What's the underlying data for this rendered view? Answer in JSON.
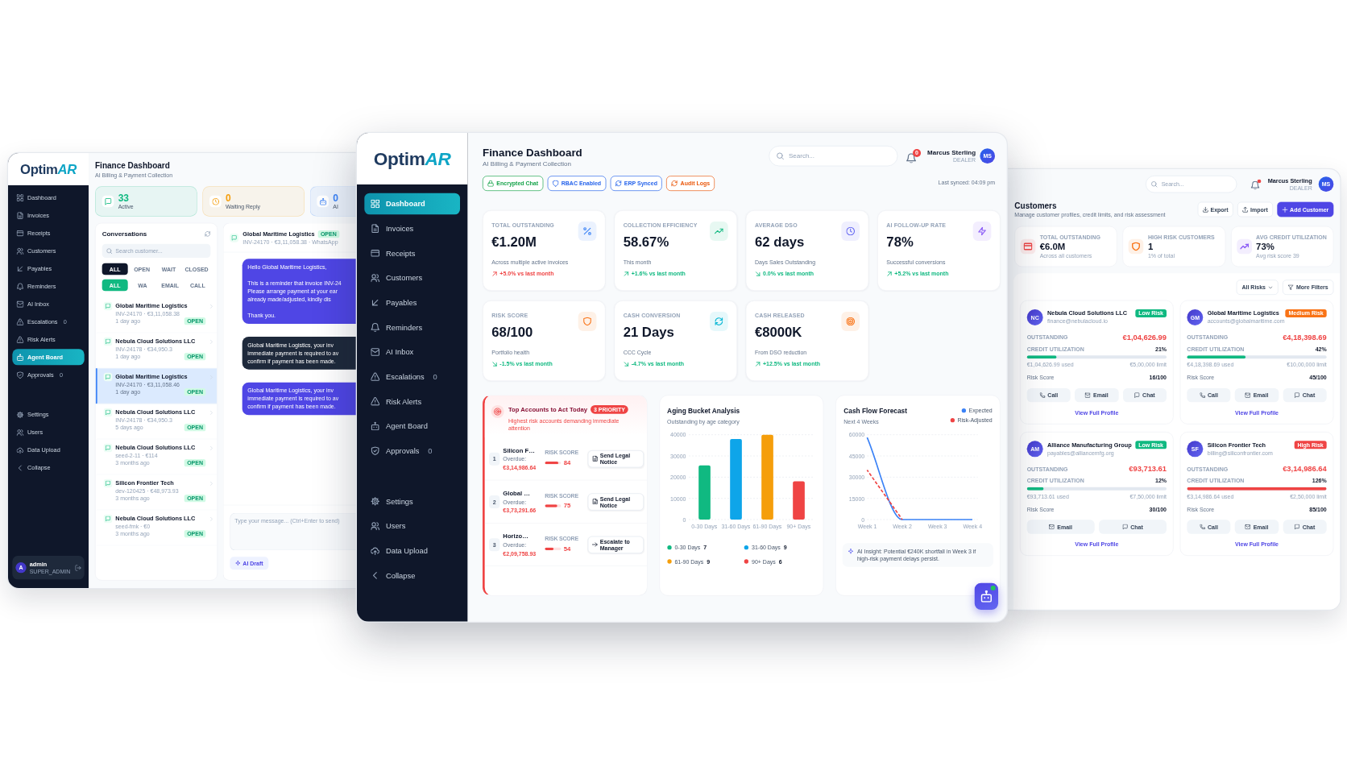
{
  "left_screen": {
    "logo": {
      "text": "Optim",
      "accent": "AR"
    },
    "sidebar": {
      "items": [
        {
          "label": "Dashboard",
          "selected": false
        },
        {
          "label": "Invoices",
          "selected": false
        },
        {
          "label": "Receipts",
          "selected": false
        },
        {
          "label": "Customers",
          "selected": false
        },
        {
          "label": "Payables",
          "selected": false
        },
        {
          "label": "Reminders",
          "selected": false
        },
        {
          "label": "AI Inbox",
          "selected": false
        },
        {
          "label": "Escalations",
          "count": "0",
          "selected": false
        },
        {
          "label": "Risk Alerts",
          "selected": false
        },
        {
          "label": "Agent Board",
          "selected": true
        },
        {
          "label": "Approvals",
          "count": "0",
          "selected": false
        }
      ],
      "footer_items": [
        {
          "label": "Settings",
          "selected": false
        },
        {
          "label": "Users",
          "selected": false
        },
        {
          "label": "Data Upload",
          "selected": false
        },
        {
          "label": "Collapse",
          "selected": false
        }
      ]
    },
    "account": {
      "initial": "A",
      "name": "admin",
      "role": "SUPER_ADMIN"
    },
    "header": {
      "title": "Finance Dashboard",
      "subtitle": "AI Billing & Payment Collection"
    },
    "stats": [
      {
        "value": "33",
        "label": "Active",
        "color": "#10b981"
      },
      {
        "value": "0",
        "label": "Waiting Reply",
        "color": "#f59e0b"
      },
      {
        "value": "0",
        "label": "AI",
        "color": "#3b82f6"
      }
    ],
    "conversations": {
      "title": "Conversations",
      "search": {
        "placeholder": "Search customer..."
      },
      "status_filters": [
        {
          "label": "ALL",
          "selected": true
        },
        {
          "label": "OPEN",
          "selected": false
        },
        {
          "label": "WAIT",
          "selected": false
        },
        {
          "label": "CLOSED",
          "selected": false
        }
      ],
      "channel_filters": [
        {
          "label": "ALL",
          "selected": true
        },
        {
          "label": "WA",
          "selected": false
        },
        {
          "label": "EMAIL",
          "selected": false
        },
        {
          "label": "CALL",
          "selected": false
        }
      ],
      "items": [
        {
          "name": "Global Maritime Logistics",
          "status": "OPEN",
          "detail": "INV-24170 · €3,11,058.38",
          "time": "1 day ago",
          "selected": false
        },
        {
          "name": "Nebula Cloud Solutions LLC",
          "status": "OPEN",
          "detail": "INV-24178 · €34,950.3",
          "time": "1 day ago",
          "selected": false
        },
        {
          "name": "Global Maritime Logistics",
          "status": "OPEN",
          "detail": "INV-24170 · €3,11,058.46",
          "time": "1 day ago",
          "selected": true
        },
        {
          "name": "Nebula Cloud Solutions LLC",
          "status": "OPEN",
          "detail": "INV-24178 · €34,950.3",
          "time": "5 days ago",
          "selected": false
        },
        {
          "name": "Nebula Cloud Solutions LLC",
          "status": "OPEN",
          "detail": "seed-2-11 · €114",
          "time": "3 months ago",
          "selected": false
        },
        {
          "name": "Silicon Frontier Tech",
          "status": "OPEN",
          "detail": "dev-120425 · €48,973.93",
          "time": "3 months ago",
          "selected": false
        },
        {
          "name": "Nebula Cloud Solutions LLC",
          "status": "OPEN",
          "detail": "seed-fmk · €0",
          "time": "3 months ago",
          "selected": false
        }
      ]
    },
    "chat": {
      "name": "Global Maritime Logistics",
      "status": "OPEN",
      "detail": "INV-24170 · €3,11,058.38 · WhatsApp",
      "messages": [
        {
          "kind": "auto",
          "paragraphs": [
            [
              "Hello Global Maritime Logistics,"
            ],
            [
              "This is a reminder that invoice INV-24",
              "Please arrange payment at your ear",
              "already made/adjusted, kindly dis"
            ],
            [
              "Thank you."
            ]
          ]
        },
        {
          "kind": "manual",
          "paragraphs": [
            [
              "Global Maritime Logistics, your inv",
              "immediate payment is required to av",
              "confirm if payment has been made."
            ]
          ]
        },
        {
          "kind": "auto",
          "paragraphs": [
            [
              "Global Maritime Logistics, your inv",
              "immediate payment is required to av",
              "confirm if payment has been made."
            ]
          ]
        }
      ],
      "composer": {
        "placeholder": "Type your message... (Ctrl+Enter to send)"
      },
      "draft_button": "AI Draft"
    }
  },
  "center_screen": {
    "logo": {
      "text": "Optim",
      "accent": "AR"
    },
    "sidebar": {
      "items": [
        {
          "label": "Dashboard",
          "selected": true
        },
        {
          "label": "Invoices",
          "selected": false
        },
        {
          "label": "Receipts",
          "selected": false
        },
        {
          "label": "Customers",
          "selected": false
        },
        {
          "label": "Payables",
          "selected": false
        },
        {
          "label": "Reminders",
          "selected": false
        },
        {
          "label": "AI Inbox",
          "selected": false
        },
        {
          "label": "Escalations",
          "count": "0",
          "selected": false
        },
        {
          "label": "Risk Alerts",
          "selected": false
        },
        {
          "label": "Agent Board",
          "selected": false
        },
        {
          "label": "Approvals",
          "count": "0",
          "selected": false
        }
      ],
      "footer_items": [
        {
          "label": "Settings",
          "selected": false
        },
        {
          "label": "Users",
          "selected": false
        },
        {
          "label": "Data Upload",
          "selected": false
        },
        {
          "label": "Collapse",
          "selected": false
        }
      ]
    },
    "header": {
      "title": "Finance Dashboard",
      "subtitle": "AI Billing & Payment Collection",
      "chips": [
        {
          "label": "Encrypted Chat",
          "color": "#16a34a"
        },
        {
          "label": "RBAC Enabled",
          "color": "#2563eb"
        },
        {
          "label": "ERP Synced",
          "color": "#2563eb"
        },
        {
          "label": "Audit Logs",
          "color": "#ea580c"
        }
      ],
      "search": {
        "placeholder": "Search..."
      },
      "notifications": "0",
      "user": {
        "name": "Marcus Sterling",
        "role": "DEALER",
        "initials": "MS"
      },
      "last_synced": "Last synced: 04:09 pm"
    },
    "kpis": [
      {
        "label": "TOTAL OUTSTANDING",
        "value": "€1.20M",
        "caption": "Across multiple active invoices",
        "trend": {
          "text": "+5.0% vs last month",
          "up": true,
          "alert": true
        }
      },
      {
        "label": "COLLECTION EFFICIENCY",
        "value": "58.67%",
        "caption": "This month",
        "trend": {
          "text": "+1.6% vs last month",
          "up": true,
          "alert": false
        }
      },
      {
        "label": "AVERAGE DSO",
        "value": "62 days",
        "caption": "Days Sales Outstanding",
        "trend": {
          "text": "0.0% vs last month",
          "up": false,
          "alert": false
        }
      },
      {
        "label": "AI FOLLOW-UP RATE",
        "value": "78%",
        "caption": "Successful conversions",
        "trend": {
          "text": "+5.2% vs last month",
          "up": true,
          "alert": false
        }
      },
      {
        "label": "RISK SCORE",
        "value": "68/100",
        "caption": "Portfolio health",
        "trend": {
          "text": "-1.5% vs last month",
          "up": false,
          "alert": false
        }
      },
      {
        "label": "CASH CONVERSION",
        "value": "21 Days",
        "caption": "CCC Cycle",
        "trend": {
          "text": "-4.7% vs last month",
          "up": false,
          "alert": false
        }
      },
      {
        "label": "CASH RELEASED",
        "value": "€8000K",
        "caption": "From DSO reduction",
        "trend": {
          "text": "+12.5% vs last month",
          "up": true,
          "alert": false
        }
      }
    ],
    "top_accounts": {
      "title": "Top Accounts to Act Today",
      "badge": "3 PRIORITY",
      "subtitle": "Highest risk accounts demanding immediate attention",
      "rows": [
        {
          "rank": "1",
          "name": "Silicon F…",
          "overdue_label": "Overdue:",
          "amount": "€3,14,986.64",
          "score_label": "RISK SCORE",
          "level": 0.84,
          "score": "84",
          "action": {
            "label": "Send Legal Notice",
            "kind": "legal"
          }
        },
        {
          "rank": "2",
          "name": "Global …",
          "overdue_label": "Overdue:",
          "amount": "€3,73,291.66",
          "score_label": "RISK SCORE",
          "level": 0.75,
          "score": "75",
          "action": {
            "label": "Send Legal Notice",
            "kind": "legal"
          }
        },
        {
          "rank": "3",
          "name": "Horizo…",
          "overdue_label": "Overdue:",
          "amount": "€2,09,758.93",
          "score_label": "RISK SCORE",
          "level": 0.54,
          "score": "54",
          "action": {
            "label": "Escalate to Manager",
            "kind": "escalate"
          }
        }
      ]
    },
    "aging": {
      "title": "Aging Bucket Analysis",
      "subtitle": "Outstanding by age category",
      "chart_data": {
        "type": "bar",
        "categories": [
          "0-30 Days",
          "31-60 Days",
          "61-90 Days",
          "90+ Days"
        ],
        "values": [
          25500,
          38000,
          40000,
          18000
        ],
        "ylim": [
          0,
          40000
        ],
        "yticks": [
          0,
          10000,
          20000,
          30000,
          40000
        ],
        "grid": true
      },
      "legend": [
        {
          "label": "0-30 Days",
          "count": "7",
          "color": "#10b981"
        },
        {
          "label": "31-60 Days",
          "count": "9",
          "color": "#0ea5e9"
        },
        {
          "label": "61-90 Days",
          "count": "9",
          "color": "#f59e0b"
        },
        {
          "label": "90+ Days",
          "count": "6",
          "color": "#ef4444"
        }
      ]
    },
    "cash_flow": {
      "title": "Cash Flow Forecast",
      "subtitle": "Next 4 Weeks",
      "chart_data": {
        "type": "line",
        "categories": [
          "Week 1",
          "Week 2",
          "Week 3",
          "Week 4"
        ],
        "series": [
          {
            "name": "Expected",
            "color": "#3b82f6",
            "values": [
              58000,
              0,
              0,
              0
            ],
            "line_style": "solid"
          },
          {
            "name": "Risk-Adjusted",
            "color": "#ef4444",
            "values": [
              35000,
              0,
              null,
              null
            ],
            "line_style": "dashed"
          }
        ],
        "ylim": [
          0,
          60000
        ],
        "yticks": [
          0,
          15000,
          30000,
          45000,
          60000
        ],
        "grid": true
      },
      "insight": "AI Insight: Potential €240K shortfall in Week 3 if high-risk payment delays persist."
    },
    "assistant": {
      "online": true
    }
  },
  "right_screen": {
    "search": {
      "placeholder": "Search..."
    },
    "notifications_unread": true,
    "user": {
      "name": "Marcus Sterling",
      "role": "DEALER",
      "initials": "MS"
    },
    "title": "Customers",
    "subtitle": "Manage customer profiles, credit limits, and risk assessment",
    "actions": [
      {
        "label": "Export",
        "kind": "export"
      },
      {
        "label": "Import",
        "kind": "import"
      },
      {
        "label": "Add Customer",
        "kind": "add"
      }
    ],
    "stats": [
      {
        "label": "TOTAL OUTSTANDING",
        "value": "€6.0M",
        "caption": "Across all customers",
        "color": "#ef4444"
      },
      {
        "label": "HIGH RISK CUSTOMERS",
        "value": "1",
        "caption": "1% of total",
        "color": "#f97316"
      },
      {
        "label": "AVG CREDIT UTILIZATION",
        "value": "73%",
        "caption": "Avg risk score 39",
        "color": "#8b5cf6"
      }
    ],
    "filters": {
      "risk": "All Risks",
      "more": "More Filters"
    },
    "customers": [
      {
        "initials": "NC",
        "name": "Nebula Cloud Solutions LLC",
        "email": "finance@nebulacloud.io",
        "risk": {
          "label": "Low Risk",
          "color": "#10b981"
        },
        "outstanding_label": "OUTSTANDING",
        "outstanding": "€1,04,626.99",
        "utilization_label": "CREDIT UTILIZATION",
        "utilization": {
          "text": "21%",
          "level": 0.21,
          "color": "#10b981"
        },
        "used": "€1,04,626.99 used",
        "limit": "€5,00,000 limit",
        "score_label": "Risk Score",
        "score": "16/100",
        "contacts": [
          {
            "label": "Call",
            "kind": "call"
          },
          {
            "label": "Email",
            "kind": "email"
          },
          {
            "label": "Chat",
            "kind": "chat"
          }
        ],
        "link": "View Full Profile"
      },
      {
        "initials": "GM",
        "name": "Global Maritime Logistics",
        "email": "accounts@globalmaritime.com",
        "risk": {
          "label": "Medium Risk",
          "color": "#f97316"
        },
        "outstanding_label": "OUTSTANDING",
        "outstanding": "€4,18,398.69",
        "utilization_label": "CREDIT UTILIZATION",
        "utilization": {
          "text": "42%",
          "level": 0.42,
          "color": "#10b981"
        },
        "used": "€4,18,398.69 used",
        "limit": "€10,00,000 limit",
        "score_label": "Risk Score",
        "score": "45/100",
        "contacts": [
          {
            "label": "Call",
            "kind": "call"
          },
          {
            "label": "Email",
            "kind": "email"
          },
          {
            "label": "Chat",
            "kind": "chat"
          }
        ],
        "link": "View Full Profile"
      },
      {
        "initials": "AM",
        "name": "Alliance Manufacturing Group",
        "email": "payables@alliancemfg.org",
        "risk": {
          "label": "Low Risk",
          "color": "#10b981"
        },
        "outstanding_label": "OUTSTANDING",
        "outstanding": "€93,713.61",
        "utilization_label": "CREDIT UTILIZATION",
        "utilization": {
          "text": "12%",
          "level": 0.12,
          "color": "#10b981"
        },
        "used": "€93,713.61 used",
        "limit": "€7,50,000 limit",
        "score_label": "Risk Score",
        "score": "30/100",
        "contacts": [
          {
            "label": "Email",
            "kind": "email"
          },
          {
            "label": "Chat",
            "kind": "chat"
          }
        ],
        "link": "View Full Profile"
      },
      {
        "initials": "SF",
        "name": "Silicon Frontier Tech",
        "email": "billing@siliconfrontier.com",
        "risk": {
          "label": "High Risk",
          "color": "#ef4444"
        },
        "outstanding_label": "OUTSTANDING",
        "outstanding": "€3,14,986.64",
        "utilization_label": "CREDIT UTILIZATION",
        "utilization": {
          "text": "126%",
          "level": 1.0,
          "color": "#ef4444"
        },
        "used": "€3,14,986.64 used",
        "limit": "€2,50,000 limit",
        "score_label": "Risk Score",
        "score": "85/100",
        "contacts": [
          {
            "label": "Call",
            "kind": "call"
          },
          {
            "label": "Email",
            "kind": "email"
          },
          {
            "label": "Chat",
            "kind": "chat"
          }
        ],
        "link": "View Full Profile"
      }
    ]
  }
}
